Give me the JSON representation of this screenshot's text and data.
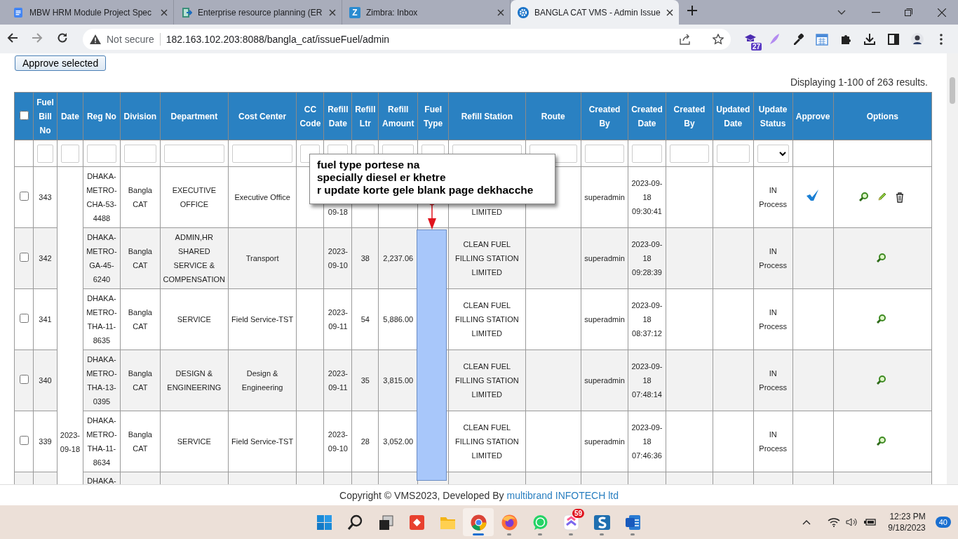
{
  "browser": {
    "tabs": [
      {
        "title": "MBW HRM Module Project Spec",
        "kind": "doc",
        "selected": false
      },
      {
        "title": "Enterprise resource planning (ER",
        "kind": "erp",
        "selected": false
      },
      {
        "title": "Zimbra: Inbox",
        "kind": "letter",
        "favicon_letter": "Z",
        "selected": false
      },
      {
        "title": "BANGLA CAT VMS - Admin Issue",
        "kind": "gear",
        "selected": true
      }
    ],
    "omnibox": {
      "security": "Not secure",
      "url": "182.163.102.203:8088/bangla_cat/issueFuel/admin"
    },
    "extensions": [
      {
        "kind": "cap",
        "badge": "27"
      },
      {
        "kind": "feather"
      },
      {
        "kind": "dropper"
      },
      {
        "kind": "calendar"
      },
      {
        "kind": "puzzle"
      },
      {
        "kind": "download"
      },
      {
        "kind": "sidebar"
      },
      {
        "kind": "avatar"
      },
      {
        "kind": "menu"
      }
    ]
  },
  "page": {
    "approve_button": "Approve selected",
    "summary": "Displaying 1-100 of 263 results.",
    "table": {
      "date_cell": "2023-09-18",
      "columns": [
        {
          "kind": "checkbox",
          "checked": false
        },
        {
          "label": "Fuel Bill No",
          "kind": "text"
        },
        {
          "label": "Date",
          "kind": "text"
        },
        {
          "label": "Reg No",
          "kind": "text"
        },
        {
          "label": "Division",
          "kind": "text"
        },
        {
          "label": "Department",
          "kind": "text"
        },
        {
          "label": "Cost Center",
          "kind": "text"
        },
        {
          "label": "CC Code",
          "kind": "text"
        },
        {
          "label": "Refill Date",
          "kind": "text"
        },
        {
          "label": "Refill Ltr",
          "kind": "text"
        },
        {
          "label": "Refill Amount",
          "kind": "text"
        },
        {
          "label": "Fuel Type",
          "kind": "text"
        },
        {
          "label": "Refill Station",
          "kind": "text"
        },
        {
          "label": "Route",
          "kind": "text"
        },
        {
          "label": "Created By",
          "kind": "text"
        },
        {
          "label": "Created Date",
          "kind": "text"
        },
        {
          "label": "Created By",
          "kind": "text"
        },
        {
          "label": "Updated Date",
          "kind": "text"
        },
        {
          "label": "Update Status",
          "kind": "select"
        },
        {
          "label": "Approve"
        },
        {
          "label": "Options"
        }
      ],
      "rows": [
        {
          "checked": false,
          "bill_no": "343",
          "reg_no": "DHAKA-METRO-CHA-53-4488",
          "division": "Bangla CAT",
          "department": "EXECUTIVE OFFICE",
          "cost_center": "Executive Office",
          "refill_date": "09-18",
          "refill_station": "LIMITED",
          "created_by": "superadmin",
          "created_date": "2023-09-18 09:30:41",
          "update_status": "IN Process",
          "approved": true,
          "options": [
            {
              "kind": "view"
            },
            {
              "kind": "edit"
            },
            {
              "kind": "delete"
            }
          ]
        },
        {
          "checked": false,
          "bill_no": "342",
          "reg_no": "DHAKA-METRO-GA-45-6240",
          "division": "Bangla CAT",
          "department": "ADMIN,HR SHARED SERVICE & COMPENSATION",
          "cost_center": "Transport",
          "refill_date": "2023-09-10",
          "refill_ltr": "38",
          "refill_amount": "2,237.06",
          "refill_station": "CLEAN FUEL FILLING STATION LIMITED",
          "created_by": "superadmin",
          "created_date": "2023-09-18 09:28:39",
          "update_status": "IN Process",
          "approved": false,
          "options": [
            {
              "kind": "view"
            }
          ]
        },
        {
          "checked": false,
          "bill_no": "341",
          "reg_no": "DHAKA-METRO-THA-11-8635",
          "division": "Bangla CAT",
          "department": "SERVICE",
          "cost_center": "Field Service-TST",
          "refill_date": "2023-09-11",
          "refill_ltr": "54",
          "refill_amount": "5,886.00",
          "refill_station": "CLEAN FUEL FILLING STATION LIMITED",
          "created_by": "superadmin",
          "created_date": "2023-09-18 08:37:12",
          "update_status": "IN Process",
          "approved": false,
          "options": [
            {
              "kind": "view"
            }
          ]
        },
        {
          "checked": false,
          "bill_no": "340",
          "reg_no": "DHAKA-METRO-THA-13-0395",
          "division": "Bangla CAT",
          "department": "DESIGN & ENGINEERING",
          "cost_center": "Design & Engineering",
          "refill_date": "2023-09-11",
          "refill_ltr": "35",
          "refill_amount": "3,815.00",
          "refill_station": "CLEAN FUEL FILLING STATION LIMITED",
          "created_by": "superadmin",
          "created_date": "2023-09-18 07:48:14",
          "update_status": "IN Process",
          "approved": false,
          "options": [
            {
              "kind": "view"
            }
          ]
        },
        {
          "checked": false,
          "bill_no": "339",
          "reg_no": "DHAKA-METRO-THA-11-8634",
          "division": "Bangla CAT",
          "department": "SERVICE",
          "cost_center": "Field Service-TST",
          "refill_date": "2023-09-10",
          "refill_ltr": "28",
          "refill_amount": "3,052.00",
          "refill_station": "CLEAN FUEL FILLING STATION LIMITED",
          "created_by": "superadmin",
          "created_date": "2023-09-18 07:46:36",
          "update_status": "IN Process",
          "approved": false,
          "options": [
            {
              "kind": "view"
            }
          ]
        },
        {
          "reg_no": "DHAKA-"
        }
      ]
    },
    "annotation": {
      "note": "fuel type portese na\nspecially diesel er khetre\nr update korte gele blank page dekhacche"
    }
  },
  "footer": {
    "text": "Copyright © VMS2023, Developed By",
    "link": "multibrand INFOTECH ltd"
  },
  "taskbar": {
    "apps": [
      {
        "kind": "windows",
        "active": false,
        "running": false
      },
      {
        "kind": "search",
        "active": false,
        "running": false
      },
      {
        "kind": "taskview",
        "active": false,
        "running": false
      },
      {
        "kind": "remote",
        "active": false,
        "running": false
      },
      {
        "kind": "folder",
        "active": false,
        "running": false
      },
      {
        "kind": "chrome",
        "active": true,
        "running": true
      },
      {
        "kind": "firefox",
        "active": false,
        "running": true
      },
      {
        "kind": "chat",
        "active": false,
        "running": true
      },
      {
        "kind": "tasks",
        "badge": "59",
        "active": false,
        "running": true
      },
      {
        "kind": "sapp",
        "active": false,
        "running": true
      },
      {
        "kind": "word",
        "active": false,
        "running": true
      }
    ],
    "time": "12:23 PM",
    "date": "9/18/2023",
    "notifications": "40"
  }
}
